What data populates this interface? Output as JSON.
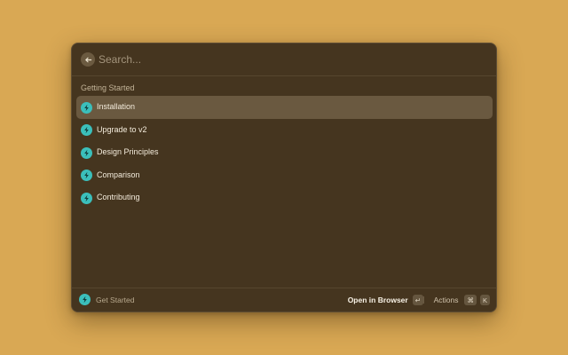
{
  "search": {
    "placeholder": "Search...",
    "value": ""
  },
  "section": {
    "title": "Getting Started"
  },
  "items": [
    {
      "label": "Installation",
      "icon": "bolt-icon",
      "selected": true
    },
    {
      "label": "Upgrade to v2",
      "icon": "bolt-icon",
      "selected": false
    },
    {
      "label": "Design Principles",
      "icon": "bolt-icon",
      "selected": false
    },
    {
      "label": "Comparison",
      "icon": "bolt-icon",
      "selected": false
    },
    {
      "label": "Contributing",
      "icon": "bolt-icon",
      "selected": false
    }
  ],
  "footer": {
    "title": "Get Started",
    "primary_action": "Open in Browser",
    "primary_key": "↵",
    "actions_label": "Actions",
    "actions_keys": [
      "⌘",
      "K"
    ]
  },
  "colors": {
    "background": "#d9a854",
    "window": "#45351f",
    "selected": "#6a5940",
    "accent": "#3bbfbb"
  }
}
